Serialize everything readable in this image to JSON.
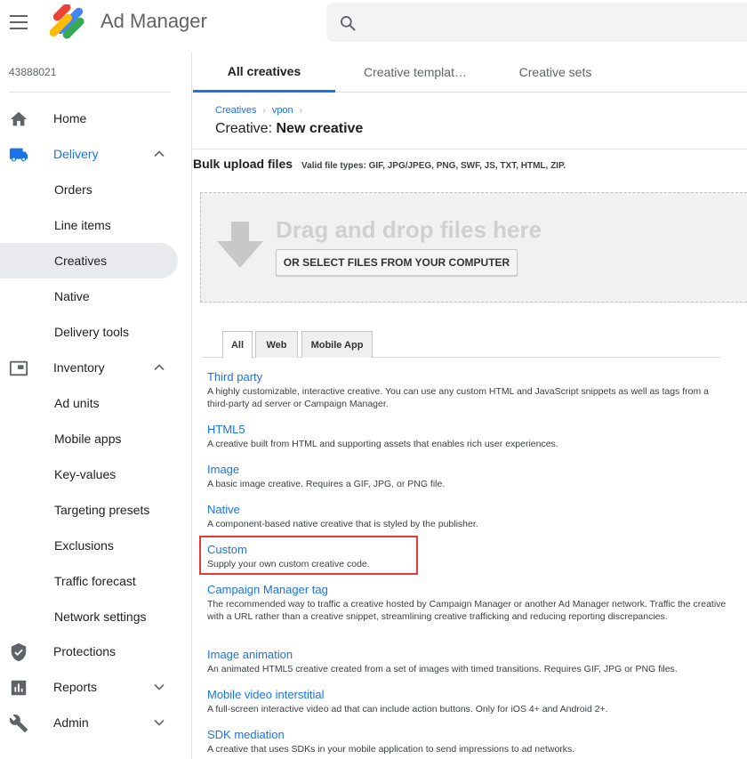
{
  "app": {
    "title": "Ad Manager",
    "network_id": "43888021"
  },
  "colors": {
    "accent": "#1a73e8",
    "highlight": "#e53935"
  },
  "sidebar": {
    "items": [
      {
        "label": "Home",
        "icon": "home-icon"
      },
      {
        "label": "Delivery",
        "icon": "truck-icon"
      },
      {
        "label": "Orders"
      },
      {
        "label": "Line items"
      },
      {
        "label": "Creatives"
      },
      {
        "label": "Native"
      },
      {
        "label": "Delivery tools"
      },
      {
        "label": "Inventory",
        "icon": "inventory-icon"
      },
      {
        "label": "Ad units"
      },
      {
        "label": "Mobile apps"
      },
      {
        "label": "Key-values"
      },
      {
        "label": "Targeting presets"
      },
      {
        "label": "Exclusions"
      },
      {
        "label": "Traffic forecast"
      },
      {
        "label": "Network settings"
      },
      {
        "label": "Protections",
        "icon": "shield-icon"
      },
      {
        "label": "Reports",
        "icon": "bar-chart-icon"
      },
      {
        "label": "Admin",
        "icon": "wrench-icon"
      }
    ]
  },
  "tabs": [
    "All creatives",
    "Creative templat…",
    "Creative sets"
  ],
  "breadcrumb": [
    "Creatives",
    "vpon"
  ],
  "page": {
    "title_prefix": "Creative:",
    "title_bold": "New creative"
  },
  "bulk": {
    "title": "Bulk upload files",
    "valid_types": "Valid file types: GIF, JPG/JPEG, PNG, SWF, JS, TXT, HTML, ZIP.",
    "drop_text": "Drag and drop files here",
    "select_button": "OR SELECT FILES FROM YOUR COMPUTER"
  },
  "type_tabs": [
    "All",
    "Web",
    "Mobile App"
  ],
  "creative_types": [
    {
      "name": "Third party",
      "desc": "A highly customizable, interactive creative. You can use any custom HTML and JavaScript snippets as well as tags from a third-party ad server or Campaign Manager."
    },
    {
      "name": "HTML5",
      "desc": "A creative built from HTML and supporting assets that enables rich user experiences."
    },
    {
      "name": "Image",
      "desc": "A basic image creative. Requires a GIF, JPG, or PNG file."
    },
    {
      "name": "Native",
      "desc": "A component-based native creative that is styled by the publisher."
    },
    {
      "name": "Custom",
      "desc": "Supply your own custom creative code."
    },
    {
      "name": "Campaign Manager tag",
      "desc": "The recommended way to traffic a creative hosted by Campaign Manager or another Ad Manager network. Traffic the creative with a URL rather than a creative snippet, streamlining creative trafficking and reducing reporting discrepancies."
    },
    {
      "name": "Image animation",
      "desc": "An animated HTML5 creative created from a set of images with timed transitions. Requires GIF, JPG or PNG files."
    },
    {
      "name": "Mobile video interstitial",
      "desc": "A full-screen interactive video ad that can include action buttons. Only for iOS 4+ and Android 2+."
    },
    {
      "name": "SDK mediation",
      "desc": "A creative that uses SDKs in your mobile application to send impressions to ad networks."
    }
  ]
}
